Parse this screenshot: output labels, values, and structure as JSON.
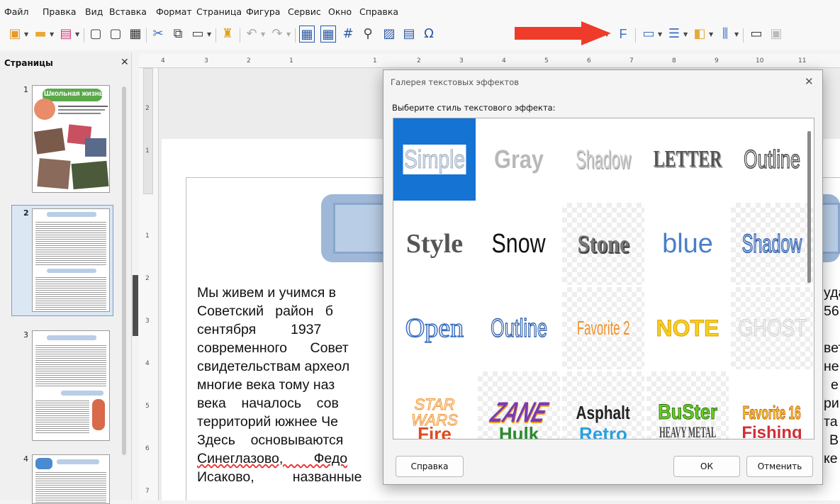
{
  "menu": [
    "Файл",
    "Правка",
    "Вид",
    "Вставка",
    "Формат",
    "Страница",
    "Фигура",
    "Сервис",
    "Окно",
    "Справка"
  ],
  "toolbar_icons": [
    "new-icon",
    "open-icon",
    "save-icon",
    "export-icon",
    "export-pdf-icon",
    "print-icon",
    "cut-icon",
    "copy-icon",
    "paste-icon",
    "clone-format-icon",
    "undo-icon",
    "redo-icon",
    "grid-icon",
    "helplines-icon",
    "snap-icon",
    "zoom-icon",
    "image-icon",
    "textbox-icon",
    "special-char-icon",
    "fontwork-icon",
    "transform-icon",
    "align-icon",
    "arrange-icon",
    "distribute-icon",
    "shadow-icon"
  ],
  "toolbar_glyph_fontwork": "F",
  "annotation_color": "#ee3b2a",
  "side_panel": {
    "title": "Страницы",
    "pages": [
      {
        "number": "1",
        "heading": "Школьная жизнь"
      },
      {
        "number": "2",
        "heading": ""
      },
      {
        "number": "3",
        "heading": ""
      },
      {
        "number": "4",
        "heading": ""
      }
    ]
  },
  "ruler_numbers": [
    "4",
    "3",
    "2",
    "1",
    "1",
    "2",
    "3",
    "4",
    "5",
    "6",
    "7",
    "8",
    "9",
    "10",
    "11"
  ],
  "vruler_numbers": [
    "2",
    "1",
    "1",
    "2",
    "3",
    "4",
    "5",
    "6",
    "7"
  ],
  "document": {
    "lines": [
      "Мы живем и учимся в",
      "Советский   район   б",
      "сентября         1937",
      "современного      Совет",
      "свидетельствам археол",
      "многие века тому наз",
      "века    началось    сов",
      "территорий южнее Че",
      "Здесь    основываются",
      "Синеглазово,        Федо",
      "Исаково,          названные            по            именам            незначительные изменения"
    ],
    "right_fragments": [
      "уда",
      "56",
      "вет",
      "не",
      "е",
      "ри",
      "та",
      "В",
      "ке"
    ]
  },
  "dialog": {
    "title": "Галерея текстовых эффектов",
    "prompt": "Выберите стиль текстового эффекта:",
    "items": [
      "Simple",
      "Gray",
      "Shadow",
      "LETTER",
      "Outline",
      "Style",
      "Snow",
      "Stone",
      "blue",
      "Shadow",
      "Open",
      "Outline",
      "Favorite 2",
      "NOTE",
      "GHOST",
      "STAR WARS",
      "ZANE",
      "Asphalt",
      "BuSter",
      "Favorite 16",
      "Fire",
      "Hulk",
      "Retro",
      "HEAVY METAL",
      "Fishing"
    ],
    "buttons": {
      "help": "Справка",
      "ok": "ОК",
      "cancel": "Отменить"
    }
  }
}
